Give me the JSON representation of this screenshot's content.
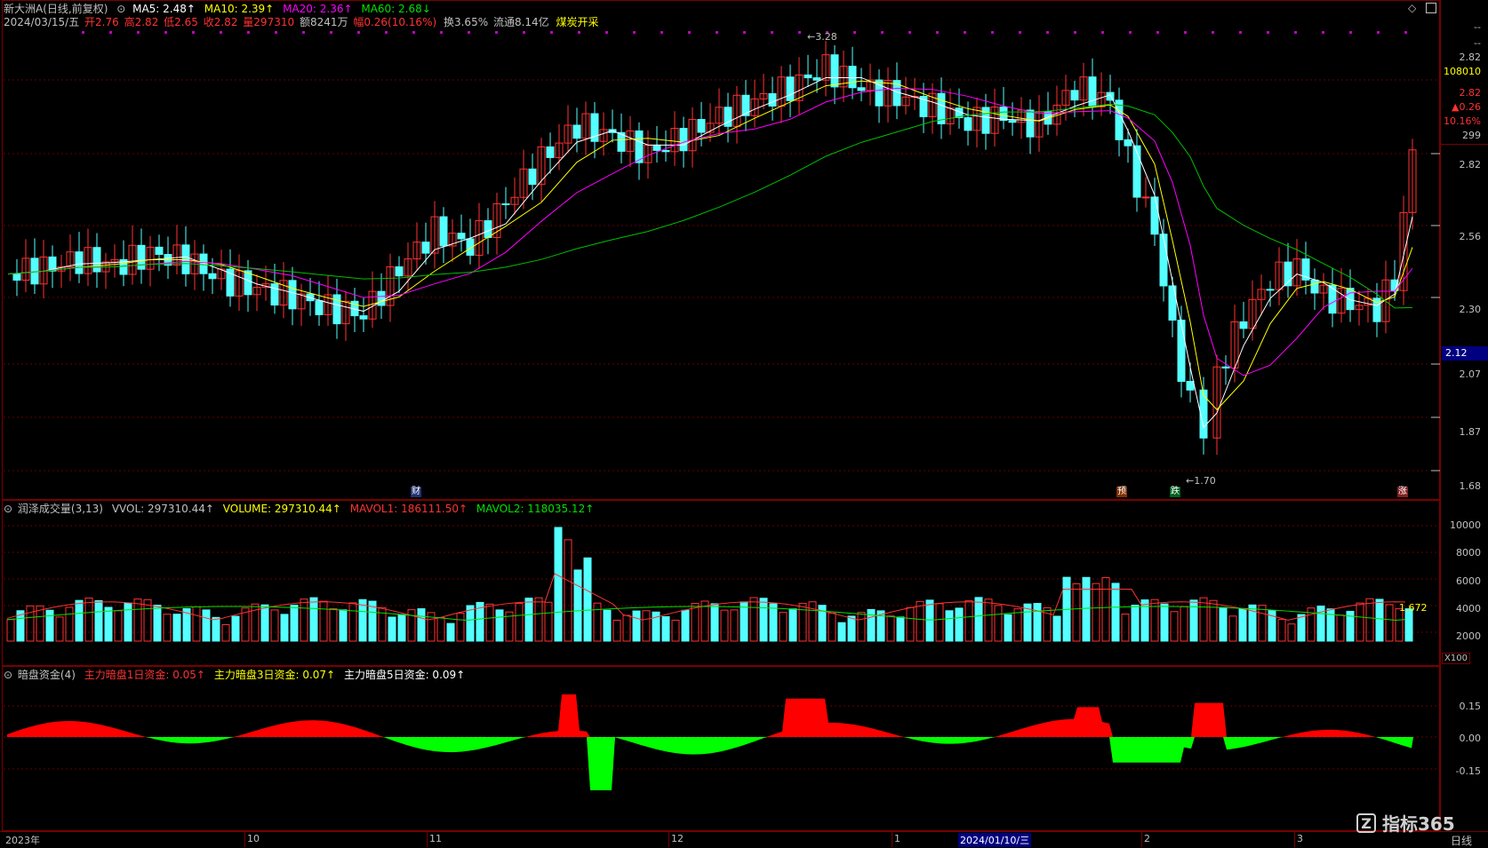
{
  "header": {
    "stock_name": "新大洲A(日线,前复权)",
    "ma5": "MA5: 2.48↑",
    "ma10": "MA10: 2.39↑",
    "ma20": "MA20: 2.36↑",
    "ma60": "MA60: 2.68↓",
    "date": "2024/03/15/五",
    "open": "开2.76",
    "high": "高2.82",
    "low": "低2.65",
    "close": "收2.82",
    "volume": "量297310",
    "amount": "额8241万",
    "change": "幅0.26(10.16%)",
    "turnover": "换3.65%",
    "float": "流通8.14亿",
    "sector": "煤炭开采"
  },
  "right_info": {
    "dash1": "--",
    "dash2": "--",
    "price1": "2.82",
    "vol": "108010",
    "price2": "2.82",
    "chg": "▲0.26",
    "pct": "10.16%",
    "num": "299",
    "current_price_tag": "2.12"
  },
  "price_axis": [
    "2.82",
    "2.56",
    "2.30",
    "2.07",
    "1.87",
    "1.68"
  ],
  "price_marks": {
    "high": "3.28",
    "low": "1.70"
  },
  "event_tags": {
    "cai": "财",
    "yu": "预",
    "die": "跌",
    "zhang": "涨"
  },
  "volume_panel": {
    "title": "润泽成交量(3,13)",
    "vvol": "VVOL: 297310.44↑",
    "volume": "VOLUME: 297310.44↑",
    "mavol1": "MAVOL1: 186111.50↑",
    "mavol2": "MAVOL2: 118035.12↑",
    "axis": [
      "10000",
      "8000",
      "6000",
      "4000",
      "2000"
    ],
    "last_label": "1.672",
    "unit": "X100"
  },
  "fund_panel": {
    "title": "暗盘资金(4)",
    "d1": "主力暗盘1日资金: 0.05↑",
    "d3": "主力暗盘3日资金: 0.07↑",
    "d5": "主力暗盘5日资金: 0.09↑",
    "axis": [
      "0.15",
      "0.00",
      "-0.15"
    ]
  },
  "x_axis": [
    "2023年",
    "10",
    "11",
    "12",
    "1",
    "2024/01/10/三",
    "2",
    "3"
  ],
  "period": "日线",
  "logo": "指标365",
  "colors": {
    "up": "#ff3232",
    "down": "#54ffff",
    "ma5": "#ffffff",
    "ma10": "#ffff00",
    "ma20": "#ff00ff",
    "ma60": "#00c000",
    "border": "#7a0000"
  }
}
